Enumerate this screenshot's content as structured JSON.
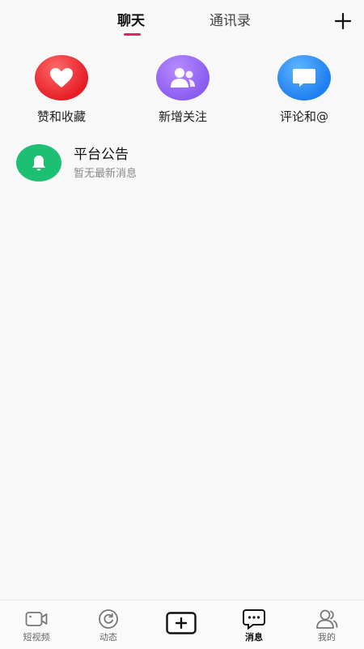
{
  "header": {
    "tabs": [
      {
        "label": "聊天",
        "active": true
      },
      {
        "label": "通讯录",
        "active": false
      }
    ],
    "plus_icon": "plus-icon",
    "accent_color": "#e0245e"
  },
  "quick_actions": [
    {
      "label": "赞和收藏",
      "icon": "heart-icon",
      "color": "#e51e25"
    },
    {
      "label": "新增关注",
      "icon": "users-icon",
      "color": "#8b5cf0"
    },
    {
      "label": "评论和@",
      "icon": "comment-icon",
      "color": "#1f7ff0"
    }
  ],
  "notices": [
    {
      "title": "平台公告",
      "subtitle": "暂无最新消息",
      "icon": "bell-icon",
      "color": "#1dbf73"
    }
  ],
  "bottom_nav": [
    {
      "label": "短视频",
      "icon": "video-camera-icon",
      "active": false
    },
    {
      "label": "动态",
      "icon": "refresh-circle-icon",
      "active": false
    },
    {
      "label": "",
      "icon": "create-plus-icon",
      "active": false
    },
    {
      "label": "消息",
      "icon": "chat-bubble-icon",
      "active": true
    },
    {
      "label": "我的",
      "icon": "user-icon",
      "active": false
    }
  ]
}
